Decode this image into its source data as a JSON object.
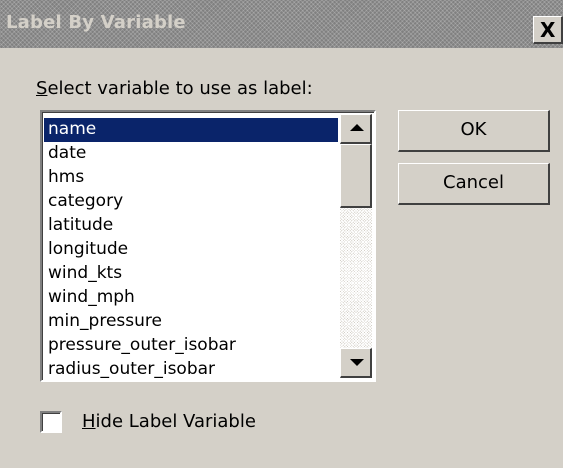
{
  "window": {
    "title": "Label By Variable",
    "close_glyph": "X"
  },
  "prompt": {
    "mnemonic": "S",
    "rest": "elect variable to use as label:"
  },
  "variables": {
    "selected_index": 0,
    "items": [
      "name",
      "date",
      "hms",
      "category",
      "latitude",
      "longitude",
      "wind_kts",
      "wind_mph",
      "min_pressure",
      "pressure_outer_isobar",
      "radius_outer_isobar"
    ]
  },
  "buttons": {
    "ok": "OK",
    "cancel": "Cancel"
  },
  "hide_label": {
    "mnemonic": "H",
    "rest": "ide Label Variable",
    "checked": false
  },
  "colors": {
    "face": "#d4d0c8",
    "selection": "#0a246a"
  }
}
